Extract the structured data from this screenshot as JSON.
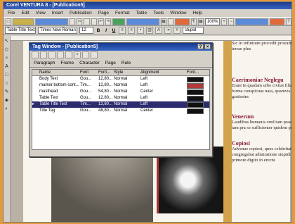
{
  "window": {
    "title": "Corel VENTURA 8 - [Publication5]"
  },
  "menu": [
    "File",
    "Edit",
    "View",
    "Insert",
    "Publication",
    "Page",
    "Format",
    "Table",
    "Tools",
    "Window",
    "Help"
  ],
  "toolbar2": {
    "tag_combo": "Table Title Text",
    "font_combo": "Times New Roman",
    "size_combo": "12",
    "zoom": "100%",
    "search_combo": "stupid"
  },
  "tag_window": {
    "title": "Tag Window - [Publication5]",
    "tabs": [
      "Paragraph",
      "Frame",
      "Character",
      "Page",
      "Rule"
    ],
    "columns": [
      "Name",
      "Font",
      "Font...",
      "Style",
      "Alignment",
      "Font..."
    ],
    "rows": [
      {
        "name": "Body Text",
        "font": "Gou...",
        "size": "12,80...",
        "style": "Normal",
        "align": "Left",
        "color": "#111111"
      },
      {
        "name": "marker bottom cont...",
        "font": "Tim...",
        "size": "12,80...",
        "style": "Normal",
        "align": "Left",
        "color": "#b23a3a"
      },
      {
        "name": "masthead",
        "font": "Gou...",
        "size": "54,80...",
        "style": "Normal",
        "align": "Center",
        "color": "#111111"
      },
      {
        "name": "Table Text",
        "font": "Gou...",
        "size": "12,80...",
        "style": "Normal",
        "align": "Left",
        "color": "#111111"
      },
      {
        "name": "Table Title Text",
        "font": "Tim...",
        "size": "12,80...",
        "style": "Normal",
        "align": "Left",
        "color": "#111111",
        "selected": true
      },
      {
        "name": "Title Tag",
        "font": "Gou...",
        "size": "48,80...",
        "style": "Normal",
        "align": "Center",
        "color": "#111111"
      }
    ]
  },
  "document": {
    "text_top": "Sic in infinitum procedit proxumas et terrae plus",
    "h1": "Caerimoniae Neglegu",
    "p1": "Erant in quadam urbe civitat filias forma conspicuas nata, quamvis gratissim",
    "h2": "Venerum",
    "p2": "Laudibus humanis cred tam praecipua, tam pra se sufficienter quidem poterat.",
    "h3": "Copiosi",
    "p3": "Advenae copiosi, quos celebritate congregabat admiratione stupidi et s primore digito in erectu"
  }
}
